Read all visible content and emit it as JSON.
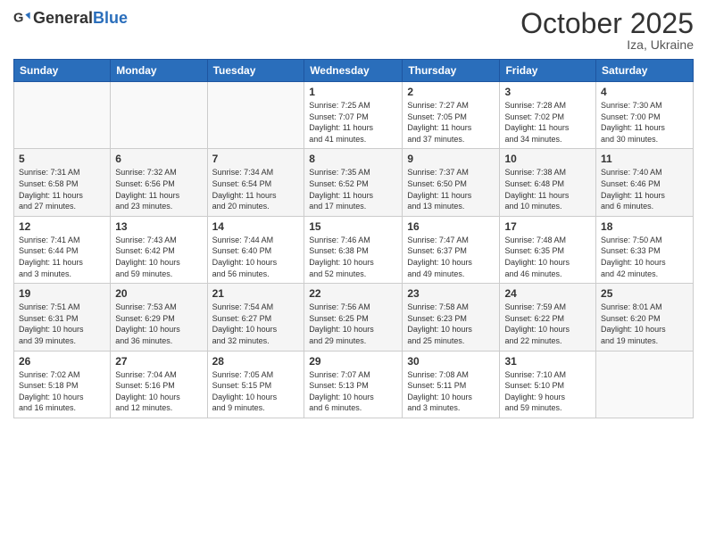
{
  "header": {
    "logo_general": "General",
    "logo_blue": "Blue",
    "month_title": "October 2025",
    "location": "Iza, Ukraine"
  },
  "weekdays": [
    "Sunday",
    "Monday",
    "Tuesday",
    "Wednesday",
    "Thursday",
    "Friday",
    "Saturday"
  ],
  "weeks": [
    [
      {
        "day": "",
        "info": ""
      },
      {
        "day": "",
        "info": ""
      },
      {
        "day": "",
        "info": ""
      },
      {
        "day": "1",
        "info": "Sunrise: 7:25 AM\nSunset: 7:07 PM\nDaylight: 11 hours\nand 41 minutes."
      },
      {
        "day": "2",
        "info": "Sunrise: 7:27 AM\nSunset: 7:05 PM\nDaylight: 11 hours\nand 37 minutes."
      },
      {
        "day": "3",
        "info": "Sunrise: 7:28 AM\nSunset: 7:02 PM\nDaylight: 11 hours\nand 34 minutes."
      },
      {
        "day": "4",
        "info": "Sunrise: 7:30 AM\nSunset: 7:00 PM\nDaylight: 11 hours\nand 30 minutes."
      }
    ],
    [
      {
        "day": "5",
        "info": "Sunrise: 7:31 AM\nSunset: 6:58 PM\nDaylight: 11 hours\nand 27 minutes."
      },
      {
        "day": "6",
        "info": "Sunrise: 7:32 AM\nSunset: 6:56 PM\nDaylight: 11 hours\nand 23 minutes."
      },
      {
        "day": "7",
        "info": "Sunrise: 7:34 AM\nSunset: 6:54 PM\nDaylight: 11 hours\nand 20 minutes."
      },
      {
        "day": "8",
        "info": "Sunrise: 7:35 AM\nSunset: 6:52 PM\nDaylight: 11 hours\nand 17 minutes."
      },
      {
        "day": "9",
        "info": "Sunrise: 7:37 AM\nSunset: 6:50 PM\nDaylight: 11 hours\nand 13 minutes."
      },
      {
        "day": "10",
        "info": "Sunrise: 7:38 AM\nSunset: 6:48 PM\nDaylight: 11 hours\nand 10 minutes."
      },
      {
        "day": "11",
        "info": "Sunrise: 7:40 AM\nSunset: 6:46 PM\nDaylight: 11 hours\nand 6 minutes."
      }
    ],
    [
      {
        "day": "12",
        "info": "Sunrise: 7:41 AM\nSunset: 6:44 PM\nDaylight: 11 hours\nand 3 minutes."
      },
      {
        "day": "13",
        "info": "Sunrise: 7:43 AM\nSunset: 6:42 PM\nDaylight: 10 hours\nand 59 minutes."
      },
      {
        "day": "14",
        "info": "Sunrise: 7:44 AM\nSunset: 6:40 PM\nDaylight: 10 hours\nand 56 minutes."
      },
      {
        "day": "15",
        "info": "Sunrise: 7:46 AM\nSunset: 6:38 PM\nDaylight: 10 hours\nand 52 minutes."
      },
      {
        "day": "16",
        "info": "Sunrise: 7:47 AM\nSunset: 6:37 PM\nDaylight: 10 hours\nand 49 minutes."
      },
      {
        "day": "17",
        "info": "Sunrise: 7:48 AM\nSunset: 6:35 PM\nDaylight: 10 hours\nand 46 minutes."
      },
      {
        "day": "18",
        "info": "Sunrise: 7:50 AM\nSunset: 6:33 PM\nDaylight: 10 hours\nand 42 minutes."
      }
    ],
    [
      {
        "day": "19",
        "info": "Sunrise: 7:51 AM\nSunset: 6:31 PM\nDaylight: 10 hours\nand 39 minutes."
      },
      {
        "day": "20",
        "info": "Sunrise: 7:53 AM\nSunset: 6:29 PM\nDaylight: 10 hours\nand 36 minutes."
      },
      {
        "day": "21",
        "info": "Sunrise: 7:54 AM\nSunset: 6:27 PM\nDaylight: 10 hours\nand 32 minutes."
      },
      {
        "day": "22",
        "info": "Sunrise: 7:56 AM\nSunset: 6:25 PM\nDaylight: 10 hours\nand 29 minutes."
      },
      {
        "day": "23",
        "info": "Sunrise: 7:58 AM\nSunset: 6:23 PM\nDaylight: 10 hours\nand 25 minutes."
      },
      {
        "day": "24",
        "info": "Sunrise: 7:59 AM\nSunset: 6:22 PM\nDaylight: 10 hours\nand 22 minutes."
      },
      {
        "day": "25",
        "info": "Sunrise: 8:01 AM\nSunset: 6:20 PM\nDaylight: 10 hours\nand 19 minutes."
      }
    ],
    [
      {
        "day": "26",
        "info": "Sunrise: 7:02 AM\nSunset: 5:18 PM\nDaylight: 10 hours\nand 16 minutes."
      },
      {
        "day": "27",
        "info": "Sunrise: 7:04 AM\nSunset: 5:16 PM\nDaylight: 10 hours\nand 12 minutes."
      },
      {
        "day": "28",
        "info": "Sunrise: 7:05 AM\nSunset: 5:15 PM\nDaylight: 10 hours\nand 9 minutes."
      },
      {
        "day": "29",
        "info": "Sunrise: 7:07 AM\nSunset: 5:13 PM\nDaylight: 10 hours\nand 6 minutes."
      },
      {
        "day": "30",
        "info": "Sunrise: 7:08 AM\nSunset: 5:11 PM\nDaylight: 10 hours\nand 3 minutes."
      },
      {
        "day": "31",
        "info": "Sunrise: 7:10 AM\nSunset: 5:10 PM\nDaylight: 9 hours\nand 59 minutes."
      },
      {
        "day": "",
        "info": ""
      }
    ]
  ]
}
